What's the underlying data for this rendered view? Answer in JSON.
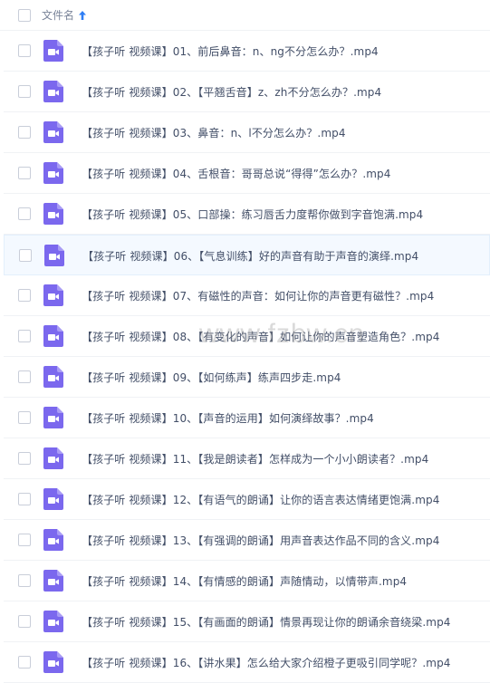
{
  "header": {
    "column_name": "文件名",
    "sort_icon": "arrow-up-icon"
  },
  "colors": {
    "icon_purple": "#7b68ee",
    "text": "#424e67",
    "header_text": "#7a8499",
    "sort_accent": "#2f7ef5",
    "hover_row_bg": "#f4f9ff"
  },
  "files": [
    {
      "name": "【孩子听 视频课】01、前后鼻音：n、ng不分怎么办？.mp4",
      "icon": "video-file-icon"
    },
    {
      "name": "【孩子听 视频课】02、【平翘舌音】z、zh不分怎么办？.mp4",
      "icon": "video-file-icon"
    },
    {
      "name": "【孩子听 视频课】03、鼻音：n、l不分怎么办？.mp4",
      "icon": "video-file-icon"
    },
    {
      "name": "【孩子听 视频课】04、舌根音：哥哥总说“得得”怎么办？.mp4",
      "icon": "video-file-icon"
    },
    {
      "name": "【孩子听 视频课】05、口部操：练习唇舌力度帮你做到字音饱满.mp4",
      "icon": "video-file-icon"
    },
    {
      "name": "【孩子听 视频课】06、【气息训练】好的声音有助于声音的演绎.mp4",
      "icon": "video-file-icon"
    },
    {
      "name": "【孩子听 视频课】07、有磁性的声音：如何让你的声音更有磁性？.mp4",
      "icon": "video-file-icon"
    },
    {
      "name": "【孩子听 视频课】08、【有变化的声音】如何让你的声音塑造角色？.mp4",
      "icon": "video-file-icon"
    },
    {
      "name": "【孩子听 视频课】09、【如何练声】练声四步走.mp4",
      "icon": "video-file-icon"
    },
    {
      "name": "【孩子听 视频课】10、【声音的运用】如何演绎故事？.mp4",
      "icon": "video-file-icon"
    },
    {
      "name": "【孩子听 视频课】11、【我是朗读者】怎样成为一个小小朗读者？.mp4",
      "icon": "video-file-icon"
    },
    {
      "name": "【孩子听 视频课】12、【有语气的朗诵】让你的语言表达情绪更饱满.mp4",
      "icon": "video-file-icon"
    },
    {
      "name": "【孩子听 视频课】13、【有强调的朗诵】用声音表达作品不同的含义.mp4",
      "icon": "video-file-icon"
    },
    {
      "name": "【孩子听 视频课】14、【有情感的朗诵】声随情动，以情带声.mp4",
      "icon": "video-file-icon"
    },
    {
      "name": "【孩子听 视频课】15、【有画面的朗诵】情景再现让你的朗诵余音绕梁.mp4",
      "icon": "video-file-icon"
    },
    {
      "name": "【孩子听 视频课】16、【讲水果】怎么给大家介绍橙子更吸引同学呢？.mp4",
      "icon": "video-file-icon"
    }
  ],
  "hovered_row": 5,
  "watermark": "www.fzbw.cn"
}
